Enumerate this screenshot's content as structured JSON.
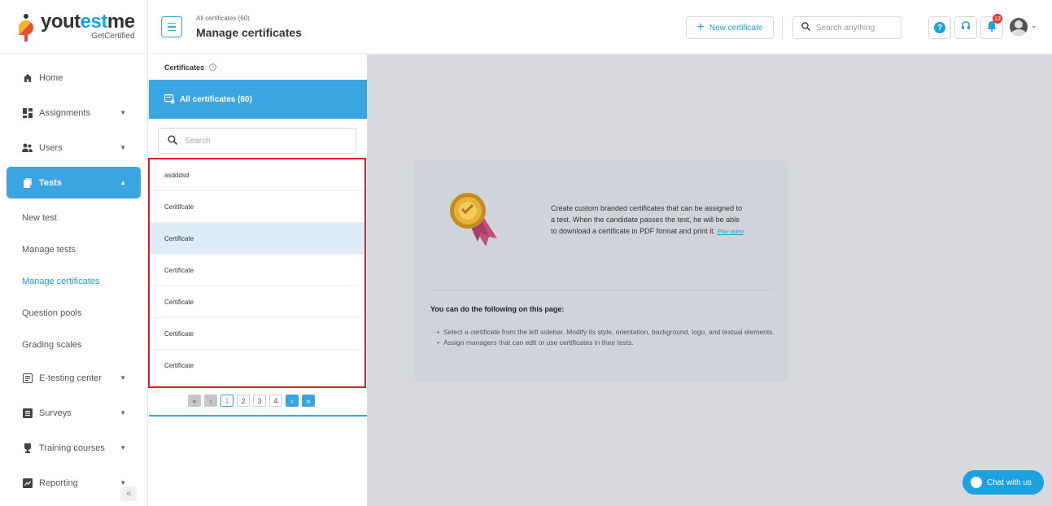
{
  "logo": {
    "main_a": "yout",
    "main_b": "est",
    "main_c": "me",
    "sub": "GetCertified"
  },
  "sidebar": {
    "home": "Home",
    "assignments": "Assignments",
    "users": "Users",
    "tests": "Tests",
    "subitems": [
      "New test",
      "Manage tests",
      "Manage certificates",
      "Question pools",
      "Grading scales"
    ],
    "etesting": "E-testing center",
    "surveys": "Surveys",
    "training": "Training courses",
    "reporting": "Reporting",
    "collapse": "«"
  },
  "header": {
    "breadcrumb": "All certificates (60)",
    "title": "Manage certificates",
    "new_button": "New certificate",
    "search_placeholder": "Search anything",
    "notification_count": "13"
  },
  "panel": {
    "title": "Certificates",
    "all_label": "All certificates (60)",
    "search_placeholder": "Search",
    "certificates": [
      "asdddsd",
      "Ceritifcate",
      "Certificate",
      "Certificate",
      "Certificate",
      "Certificate",
      "Certificate"
    ],
    "pager": {
      "first": "«",
      "prev": "‹",
      "pages": [
        "1",
        "2",
        "3",
        "4"
      ],
      "next": "›",
      "last": "»"
    }
  },
  "card": {
    "description": "Create custom branded certificates that can be assigned to a test. When the candidate passes the test, he will be able to download a certificate in PDF format and print it.",
    "link": "Play video",
    "heading": "You can do the following on this page:",
    "bullets": [
      "Select a certificate from the left sidebar. Modify its style, orientation, background, logo, and textual elements.",
      "Assign managers that can edit or use certificates in their tests."
    ]
  },
  "chat": {
    "label": "Chat with us"
  },
  "colors": {
    "accent": "#3ba5e2",
    "highlight": "#e01b24",
    "selected_row": "#deebf9"
  }
}
